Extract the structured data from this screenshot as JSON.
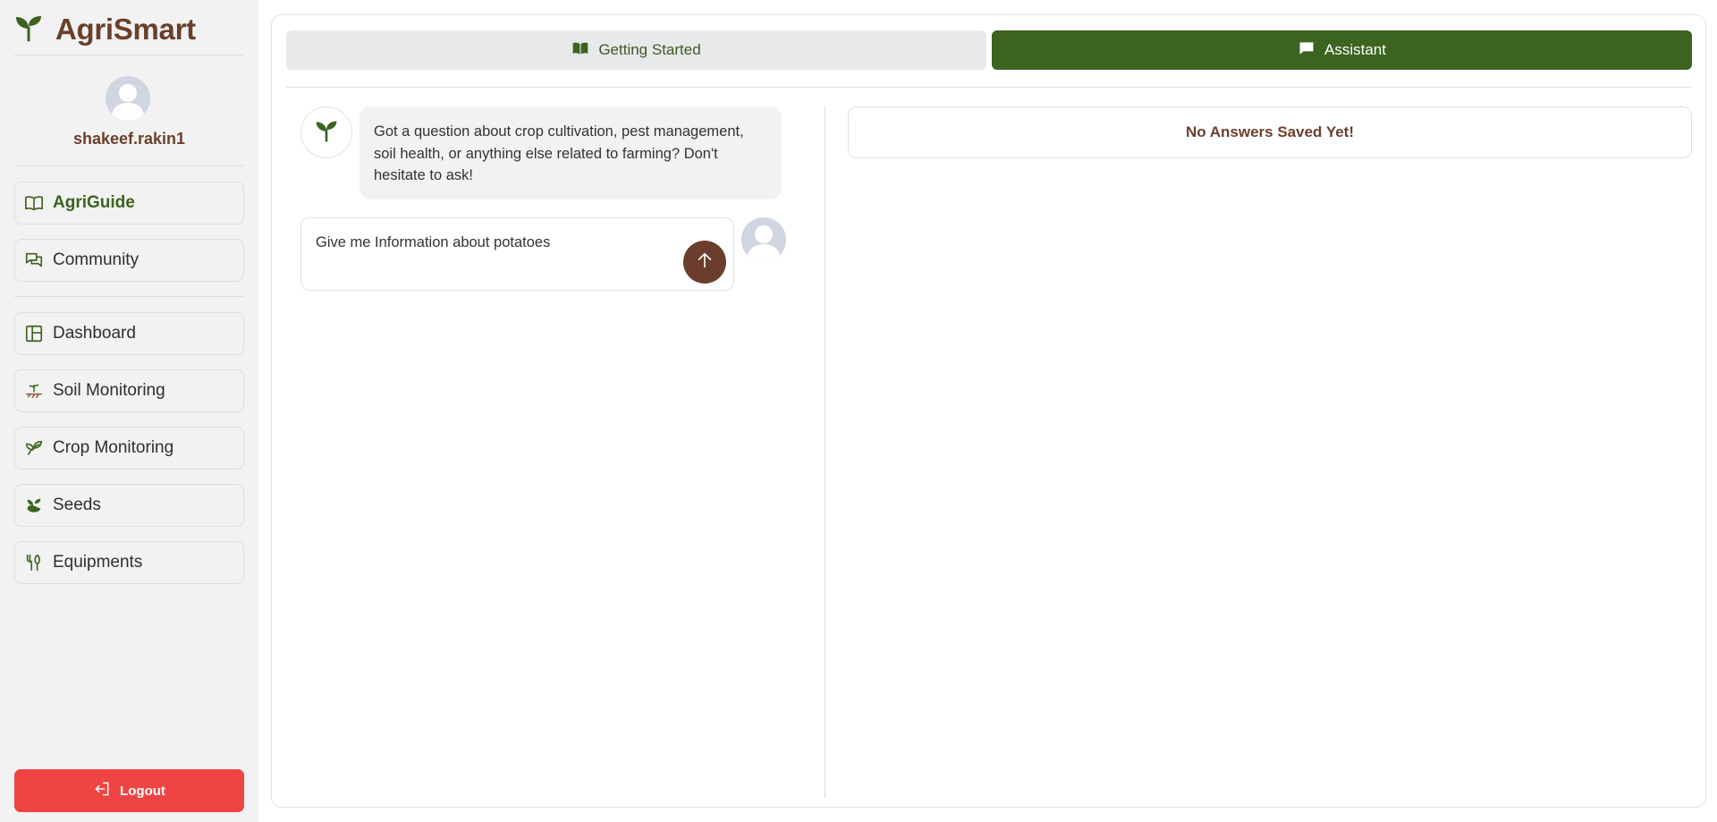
{
  "brand": {
    "name": "AgriSmart",
    "icon": "sprout-icon",
    "color": "#6b3f2c"
  },
  "user": {
    "username": "shakeef.rakin1",
    "avatar": "user-avatar"
  },
  "nav": {
    "primary": [
      {
        "label": "AgriGuide",
        "icon": "book-open-icon",
        "active": true
      },
      {
        "label": "Community",
        "icon": "chat-bubbles-icon",
        "active": false
      }
    ],
    "secondary": [
      {
        "label": "Dashboard",
        "icon": "dashboard-icon"
      },
      {
        "label": "Soil Monitoring",
        "icon": "soil-icon"
      },
      {
        "label": "Crop Monitoring",
        "icon": "leaf-icon"
      },
      {
        "label": "Seeds",
        "icon": "seed-icon"
      },
      {
        "label": "Equipments",
        "icon": "tools-icon"
      }
    ]
  },
  "logout": {
    "label": "Logout",
    "color": "#ef4444"
  },
  "tabs": [
    {
      "label": "Getting Started",
      "icon": "book-icon",
      "active": false
    },
    {
      "label": "Assistant",
      "icon": "message-icon",
      "active": true
    }
  ],
  "chat": {
    "bot_message": "Got a question about crop cultivation, pest management, soil health, or anything else related to farming? Don't hesitate to ask!",
    "input_value": "Give me Information about potatoes",
    "send_icon": "arrow-up-icon"
  },
  "saved": {
    "empty_text": "No Answers Saved Yet!"
  },
  "colors": {
    "accent_green": "#3d6320",
    "brown": "#6b3d2c",
    "sidebar_bg": "#f2f2f2"
  }
}
